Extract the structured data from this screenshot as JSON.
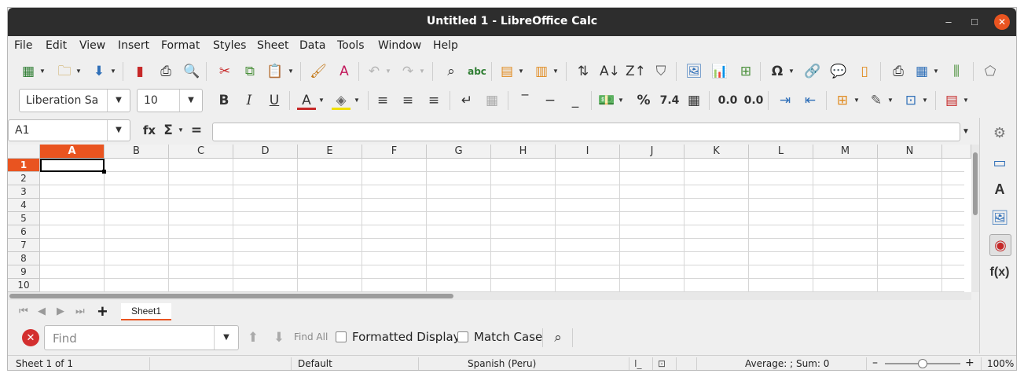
{
  "window": {
    "title": "Untitled 1 - LibreOffice Calc",
    "minimize": "–",
    "maximize": "□",
    "close": "✕"
  },
  "menu": [
    "File",
    "Edit",
    "View",
    "Insert",
    "Format",
    "Styles",
    "Sheet",
    "Data",
    "Tools",
    "Window",
    "Help"
  ],
  "format_bar": {
    "font_name": "Liberation Sa",
    "font_size": "10",
    "bold": "B",
    "italic": "I",
    "underline": "U",
    "percent": "%",
    "decimal": "7.4",
    "add_decimal": "0.0",
    "del_decimal": "0.0"
  },
  "formula_bar": {
    "cell_ref": "A1",
    "fx": "fx",
    "sum": "Σ",
    "equals": "="
  },
  "columns": [
    "A",
    "B",
    "C",
    "D",
    "E",
    "F",
    "G",
    "H",
    "I",
    "J",
    "K",
    "L",
    "M",
    "N"
  ],
  "rows": [
    "1",
    "2",
    "3",
    "4",
    "5",
    "6",
    "7",
    "8",
    "9",
    "10"
  ],
  "sheet_tabs": {
    "add": "+",
    "active": "Sheet1"
  },
  "find_bar": {
    "placeholder": "Find",
    "find_all": "Find All",
    "formatted_display": "Formatted Display",
    "match_case": "Match Case"
  },
  "status_bar": {
    "sheet": "Sheet 1 of 1",
    "page_style": "Default",
    "language": "Spanish (Peru)",
    "summary": "Average: ; Sum: 0",
    "zoom": "100%",
    "zoom_minus": "–",
    "zoom_plus": "+"
  },
  "colors": {
    "accent": "#e95420",
    "titlebar": "#2d2d2d"
  }
}
